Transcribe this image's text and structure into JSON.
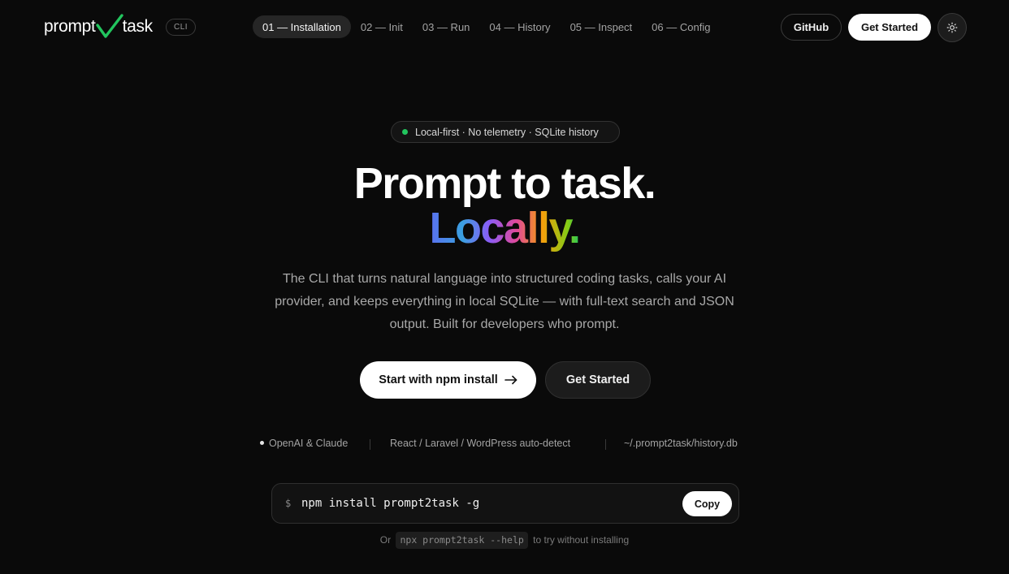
{
  "nav": {
    "logo_left": "prompt",
    "logo_right": "task",
    "badge": "CLI",
    "links": [
      {
        "label": "01 — Installation",
        "active": true
      },
      {
        "label": "02 — Init",
        "active": false
      },
      {
        "label": "03 — Run",
        "active": false
      },
      {
        "label": "04 — History",
        "active": false
      },
      {
        "label": "05 — Inspect",
        "active": false
      },
      {
        "label": "06 — Config",
        "active": false
      }
    ],
    "github_label": "GitHub",
    "get_started_label": "Get Started",
    "theme_icon": "sun-icon"
  },
  "hero": {
    "pill_text": "Local-first · No telemetry · SQLite history",
    "pill_dot_color": "#22c55e",
    "title_line1": "Prompt to task.",
    "title_line2": "Locally.",
    "description": "The CLI that turns natural language into structured coding tasks, calls your AI provider, and keeps everything in local SQLite — with full-text search and JSON output. Built for developers who prompt.",
    "primary_cta": "Start with npm install",
    "primary_cta_icon": "arrow-right-icon",
    "secondary_cta": "Get Started"
  },
  "features": [
    "OpenAI & Claude",
    "React / Laravel / WordPress auto-detect",
    "~/.prompt2task/history.db"
  ],
  "install": {
    "prompt": "$",
    "command": "npm install prompt2task -g",
    "copy_label": "Copy",
    "hint_before": "Or",
    "hint_code": "npx prompt2task --help",
    "hint_after": "to try without installing"
  },
  "colors": {
    "background": "#0a0a0a",
    "accent_green": "#22c55e",
    "primary_button": "#ffffff"
  }
}
